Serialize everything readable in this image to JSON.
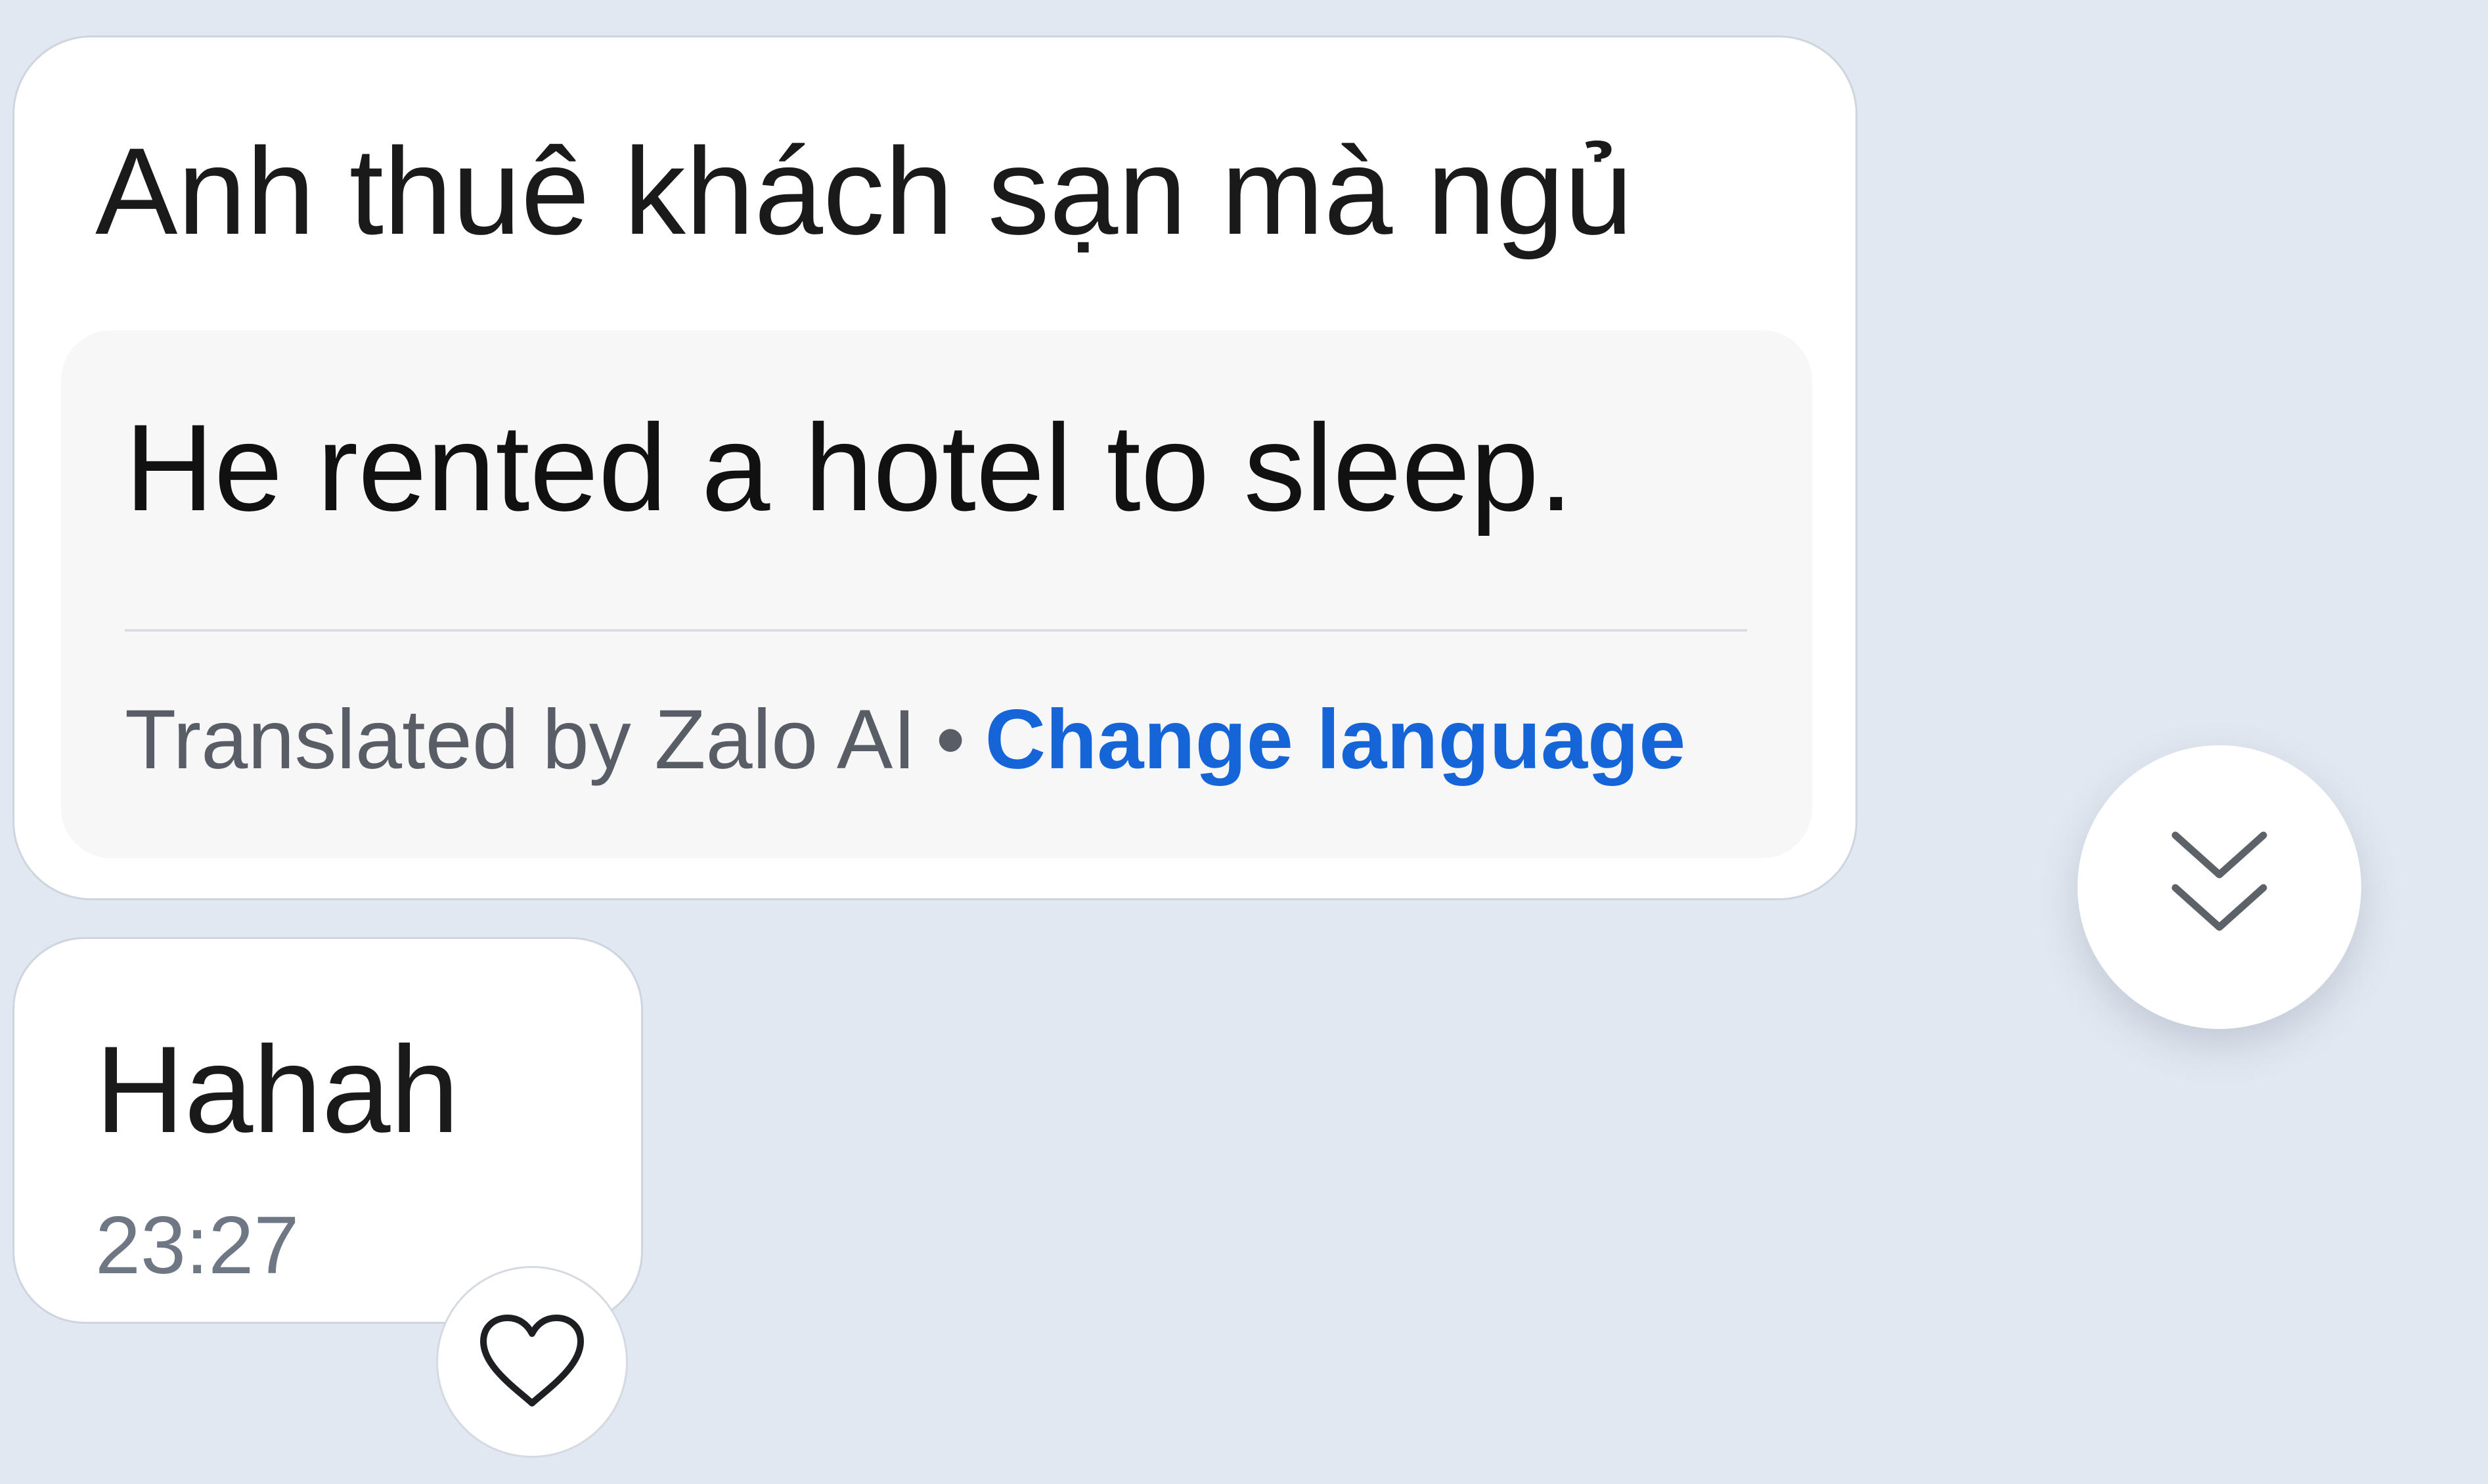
{
  "messages": [
    {
      "text": "Anh thuê khách sạn mà ngủ",
      "translation": {
        "text": "He rented a hotel to sleep.",
        "credit": "Translated by Zalo AI",
        "separator": "•",
        "change_language_label": "Change language"
      }
    },
    {
      "text": "Hahah",
      "time": "23:27"
    }
  ],
  "icons": {
    "scroll_down": "double-chevron-down-icon",
    "react": "heart-outline-icon"
  },
  "colors": {
    "background": "#e2e8f1",
    "bubble": "#ffffff",
    "link": "#1565d8",
    "timestamp": "#6f7785"
  }
}
